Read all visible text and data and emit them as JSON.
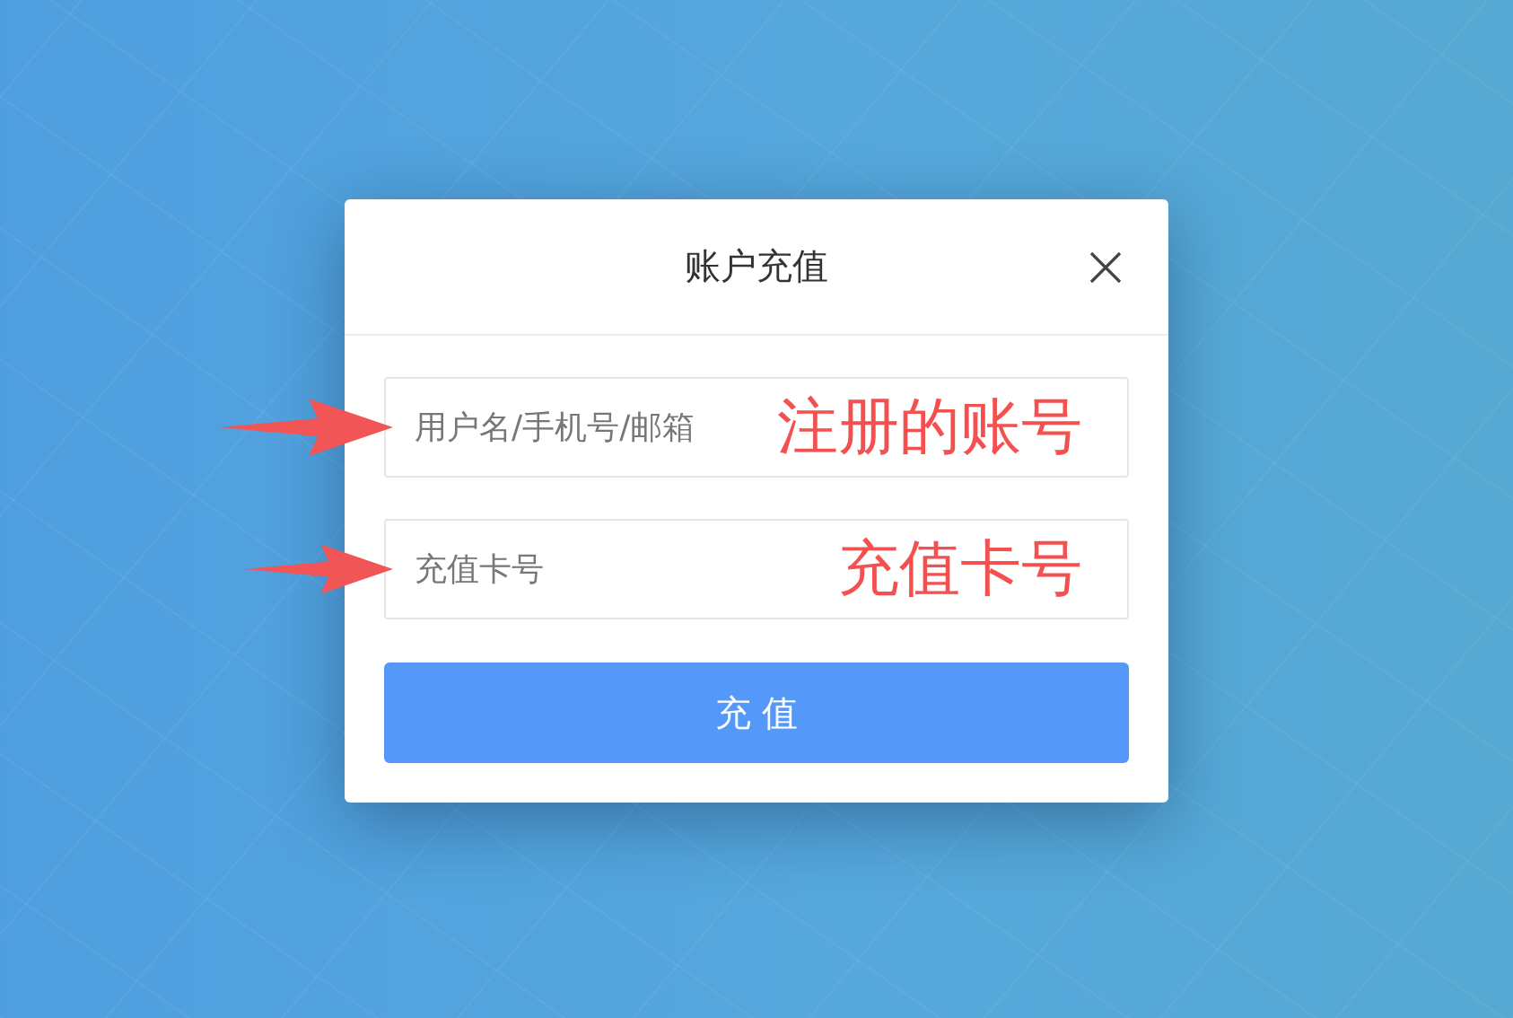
{
  "dialog": {
    "title": "账户充值",
    "fields": [
      {
        "placeholder": "用户名/手机号/邮箱",
        "annotation": "注册的账号"
      },
      {
        "placeholder": "充值卡号",
        "annotation": "充值卡号"
      }
    ],
    "submit_button": "充 值"
  }
}
